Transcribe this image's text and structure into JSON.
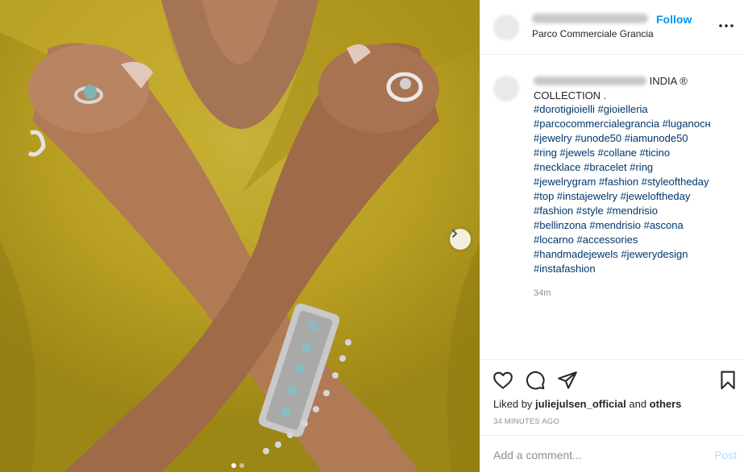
{
  "header": {
    "location": "Parco Commerciale Grancia",
    "follow_label": "Follow"
  },
  "caption": {
    "text": "INDIA ® COLLECTION .",
    "hashtags": [
      "#dorotigioielli #gioielleria",
      "#parcocommercialegrancia #luganocн",
      "#jewelry #unode50 #iamunode50",
      "#ring #jewels #collane #ticino",
      "#necklace #bracelet #ring",
      "#jewelrygram #fashion #styleoftheday",
      "#top #instajewelry #jeweloftheday",
      "#fashion #style #mendrisio",
      "#bellinzona #mendrisio #ascona",
      "#locarno #accessories",
      "#handmadejewels #jewerydesign",
      "#instafashion"
    ],
    "age": "34m"
  },
  "likes": {
    "prefix": "Liked by ",
    "user": "juliejulsen_official",
    "middle": " and ",
    "others": "others"
  },
  "timestamp": "34 MINUTES AGO",
  "comment": {
    "placeholder": "Add a comment...",
    "post_label": "Post"
  },
  "carousel": {
    "count": 2,
    "active_index": 0
  },
  "colors": {
    "follow_blue": "#0095f6",
    "hashtag_blue": "#00376b",
    "post_disabled": "#b2dffc",
    "muted_gray": "#8e8e8e",
    "blouse_yellow": "#b89f22"
  },
  "icons": [
    "chevron-right-icon",
    "more-options-icon",
    "heart-icon",
    "comment-icon",
    "share-icon",
    "bookmark-icon"
  ]
}
